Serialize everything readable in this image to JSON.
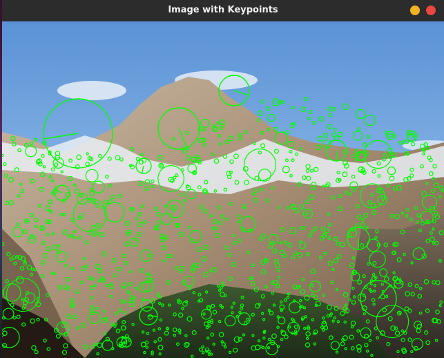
{
  "window": {
    "title": "Image with Keypoints",
    "buttons": [
      {
        "name": "minimize-button",
        "color": "#f4b324"
      },
      {
        "name": "close-button",
        "color": "#e9473f"
      }
    ]
  },
  "image": {
    "subject": "mountain-landscape-photo",
    "keypoint_color": "#00ff00"
  }
}
